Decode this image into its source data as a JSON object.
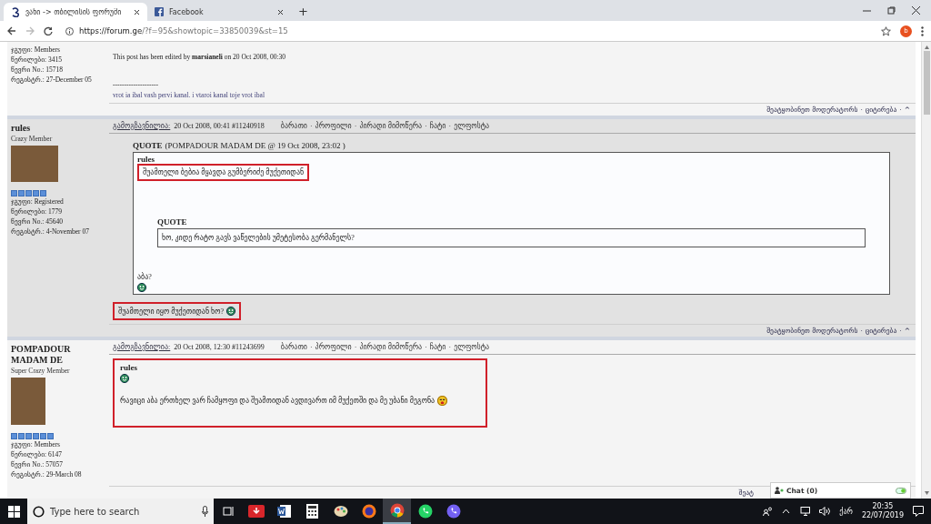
{
  "browser": {
    "tabs": [
      {
        "title": "ვანი -> თბილისის ფორუმი",
        "selected": true
      },
      {
        "title": "Facebook",
        "selected": false
      }
    ],
    "new_tab": "+",
    "url": {
      "host": "https://forum.ge",
      "path": "/?f=95&showtopic=33850039&st=15"
    },
    "profile": "b"
  },
  "separator": "·",
  "posts": [
    {
      "shaded": false,
      "stats": [
        "ჯგუფი: Members",
        "წერილები: 3415",
        "წევრი No.: 15718",
        "რეგისტრ.: 27-December 05"
      ],
      "body": [
        {
          "kind": "edit_note",
          "text": "This post has been edited by **marsianeli** on 20 Oct 2008, 00:30"
        },
        {
          "kind": "rule",
          "text": "--------------------"
        },
        {
          "kind": "signature",
          "text": "vrot ia ibal vash pervi kanal. i vtaroi kanal toje vrot ibal"
        }
      ],
      "footer": [
        "შეატყობინეთ მოდერატორს",
        "ციტირება",
        "^"
      ]
    },
    {
      "shaded": true,
      "author": "rules",
      "rank": "Crazy Member",
      "has_avatar": true,
      "stars": 5,
      "stats": [
        "ჯგუფი: Registered",
        "წერილები: 1779",
        "წევრი No.: 45640",
        "რეგისტრ.: 4-November 07"
      ],
      "header": {
        "label": "გამოგზავნილია:",
        "meta": "20 Oct 2008, 00:41  #11240918",
        "actions": [
          "ბარათი",
          "პროფილი",
          "პირადი მიმოწერა",
          "ჩატი",
          "ელფოსტა"
        ]
      },
      "body": [
        {
          "kind": "quote",
          "label": "QUOTE",
          "source": "(POMPADOUR MADAM DE @ 19 Oct 2008, 23:02 )",
          "children": [
            {
              "kind": "author",
              "text": "rules"
            },
            {
              "kind": "text",
              "text": "შუამთელი ბებია მყავდა გუმბერიძე მუქეთიდან",
              "highlighted": true
            },
            {
              "kind": "quote",
              "label": "QUOTE",
              "children": [
                {
                  "kind": "text",
                  "text": "ხო, კიდე რატო გავს ვაწელების უმეტესობა გერმანელს?",
                  "highlighted": false
                }
              ]
            },
            {
              "kind": "text",
              "text": "აბა?",
              "highlighted": false
            },
            {
              "kind": "smiley"
            }
          ]
        },
        {
          "kind": "text_smiley",
          "text": "შუამთელი იყო მუქეთიდან ხო?",
          "highlighted": true
        }
      ],
      "footer": [
        "შეატყობინეთ მოდერატორს",
        "ციტირება",
        "^"
      ]
    },
    {
      "shaded": false,
      "author": "POMPADOUR MADAM DE",
      "rank": "Super Crazy Member",
      "has_avatar": true,
      "stars": 6,
      "stats": [
        "ჯგუფი: Members",
        "წერილები: 6147",
        "წევრი No.: 57057",
        "რეგისტრ.: 29-March 08"
      ],
      "header": {
        "label": "გამოგზავნილია:",
        "meta": "20 Oct 2008, 12:30  #11243699",
        "actions": [
          "ბარათი",
          "პროფილი",
          "პირადი მიმოწერა",
          "ჩატი",
          "ელფოსტა"
        ]
      },
      "body": [
        {
          "kind": "group",
          "highlighted": true,
          "children": [
            {
              "kind": "author",
              "text": "rules"
            },
            {
              "kind": "smiley"
            },
            {
              "kind": "text_emoji",
              "text": "რავიცი აბა ერთხელ ვარ ჩამყოფი და შუამთიდან ავდივართ იმ მუქეთში და მე უბანი მეგონა",
              "highlighted": false
            }
          ]
        }
      ],
      "footer": [
        "შეატ"
      ]
    }
  ],
  "chat": {
    "label": "Chat (0)"
  },
  "taskbar": {
    "search_placeholder": "Type here to search",
    "apps": [
      {
        "kind": "task-view",
        "selected": false
      },
      {
        "kind": "download",
        "selected": false
      },
      {
        "kind": "word",
        "selected": false
      },
      {
        "kind": "calculator",
        "selected": false
      },
      {
        "kind": "paint",
        "selected": false
      },
      {
        "kind": "firefox",
        "selected": false
      },
      {
        "kind": "chrome",
        "selected": true
      },
      {
        "kind": "whatsapp",
        "selected": false
      },
      {
        "kind": "viber",
        "selected": false
      }
    ],
    "language": "ქარ",
    "time": "20:35",
    "date": "22/07/2019"
  }
}
